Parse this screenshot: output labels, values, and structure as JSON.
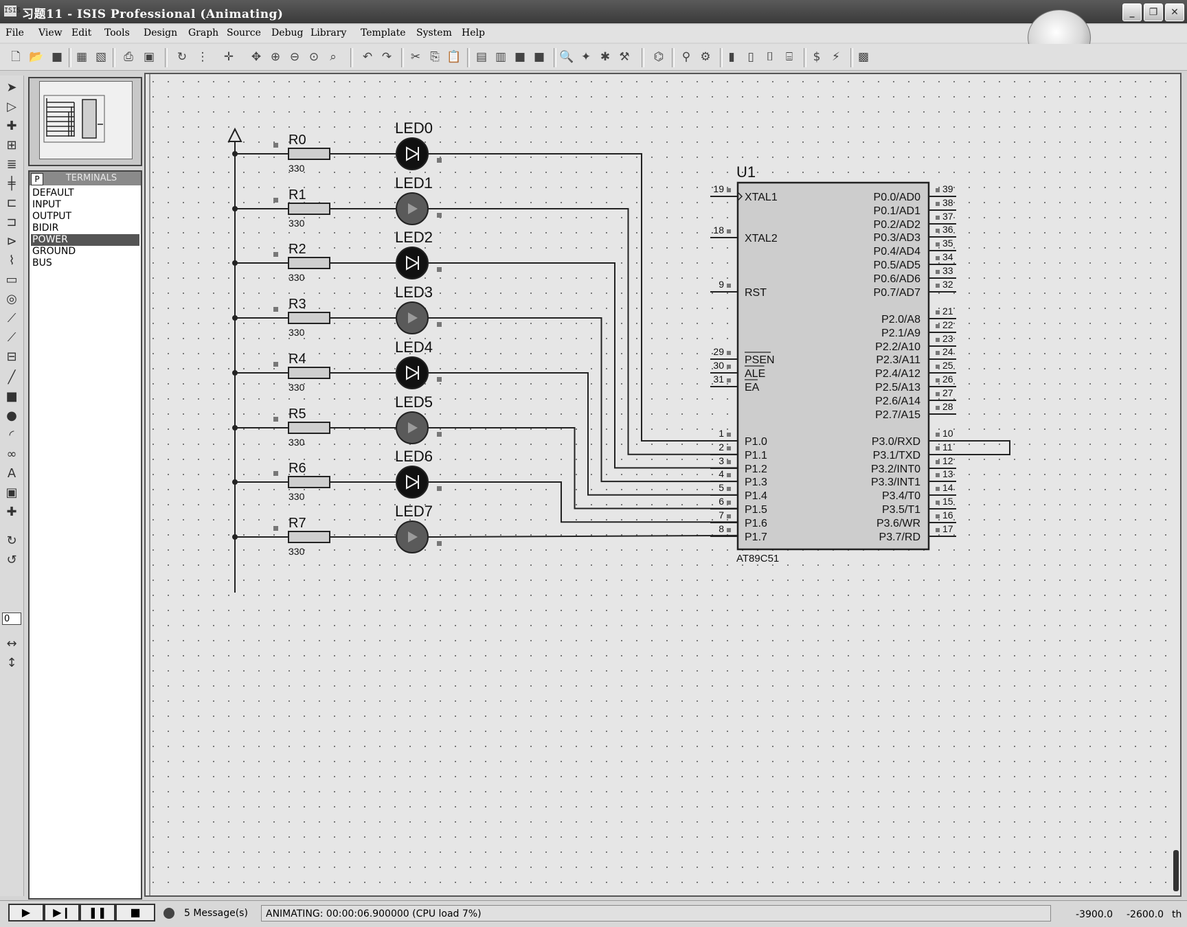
{
  "window": {
    "title": "习题11 - ISIS Professional (Animating)",
    "app_icon": "ISIS"
  },
  "menu": [
    {
      "label": "File"
    },
    {
      "label": "View"
    },
    {
      "label": "Edit"
    },
    {
      "label": "Tools"
    },
    {
      "label": "Design"
    },
    {
      "label": "Graph"
    },
    {
      "label": "Source"
    },
    {
      "label": "Debug"
    },
    {
      "label": "Library"
    },
    {
      "label": "Template"
    },
    {
      "label": "System"
    },
    {
      "label": "Help"
    }
  ],
  "device_panel": {
    "mode_button": "P",
    "header": "TERMINALS",
    "items": [
      "DEFAULT",
      "INPUT",
      "OUTPUT",
      "BIDIR",
      "POWER",
      "GROUND",
      "BUS"
    ],
    "selected": "POWER"
  },
  "rotation_value": "0",
  "schematic": {
    "resistors": [
      {
        "ref": "R0",
        "value": "330"
      },
      {
        "ref": "R1",
        "value": "330"
      },
      {
        "ref": "R2",
        "value": "330"
      },
      {
        "ref": "R3",
        "value": "330"
      },
      {
        "ref": "R4",
        "value": "330"
      },
      {
        "ref": "R5",
        "value": "330"
      },
      {
        "ref": "R6",
        "value": "330"
      },
      {
        "ref": "R7",
        "value": "330"
      }
    ],
    "leds": [
      {
        "ref": "LED0",
        "state": "off"
      },
      {
        "ref": "LED1",
        "state": "on"
      },
      {
        "ref": "LED2",
        "state": "off"
      },
      {
        "ref": "LED3",
        "state": "on"
      },
      {
        "ref": "LED4",
        "state": "off"
      },
      {
        "ref": "LED5",
        "state": "on"
      },
      {
        "ref": "LED6",
        "state": "off"
      },
      {
        "ref": "LED7",
        "state": "on"
      }
    ],
    "mcu": {
      "ref": "U1",
      "part": "AT89C51",
      "left_pins": [
        {
          "num": "19",
          "name": "XTAL1"
        },
        {
          "num": "18",
          "name": "XTAL2"
        },
        {
          "num": "9",
          "name": "RST"
        },
        {
          "num": "29",
          "name": "PSEN"
        },
        {
          "num": "30",
          "name": "ALE"
        },
        {
          "num": "31",
          "name": "EA"
        },
        {
          "num": "1",
          "name": "P1.0"
        },
        {
          "num": "2",
          "name": "P1.1"
        },
        {
          "num": "3",
          "name": "P1.2"
        },
        {
          "num": "4",
          "name": "P1.3"
        },
        {
          "num": "5",
          "name": "P1.4"
        },
        {
          "num": "6",
          "name": "P1.5"
        },
        {
          "num": "7",
          "name": "P1.6"
        },
        {
          "num": "8",
          "name": "P1.7"
        }
      ],
      "right_pins": [
        {
          "num": "39",
          "name": "P0.0/AD0"
        },
        {
          "num": "38",
          "name": "P0.1/AD1"
        },
        {
          "num": "37",
          "name": "P0.2/AD2"
        },
        {
          "num": "36",
          "name": "P0.3/AD3"
        },
        {
          "num": "35",
          "name": "P0.4/AD4"
        },
        {
          "num": "34",
          "name": "P0.5/AD5"
        },
        {
          "num": "33",
          "name": "P0.6/AD6"
        },
        {
          "num": "32",
          "name": "P0.7/AD7"
        },
        {
          "num": "21",
          "name": "P2.0/A8"
        },
        {
          "num": "22",
          "name": "P2.1/A9"
        },
        {
          "num": "23",
          "name": "P2.2/A10"
        },
        {
          "num": "24",
          "name": "P2.3/A11"
        },
        {
          "num": "25",
          "name": "P2.4/A12"
        },
        {
          "num": "26",
          "name": "P2.5/A13"
        },
        {
          "num": "27",
          "name": "P2.6/A14"
        },
        {
          "num": "28",
          "name": "P2.7/A15"
        },
        {
          "num": "10",
          "name": "P3.0/RXD"
        },
        {
          "num": "11",
          "name": "P3.1/TXD"
        },
        {
          "num": "12",
          "name": "P3.2/INT0"
        },
        {
          "num": "13",
          "name": "P3.3/INT1"
        },
        {
          "num": "14",
          "name": "P3.4/T0"
        },
        {
          "num": "15",
          "name": "P3.5/T1"
        },
        {
          "num": "16",
          "name": "P3.6/WR"
        },
        {
          "num": "17",
          "name": "P3.7/RD"
        }
      ]
    }
  },
  "status": {
    "messages": "5 Message(s)",
    "animating": "ANIMATING: 00:00:06.900000 (CPU load 7%)",
    "x": "-3900.0",
    "y": "-2600.0",
    "unit": "th"
  }
}
